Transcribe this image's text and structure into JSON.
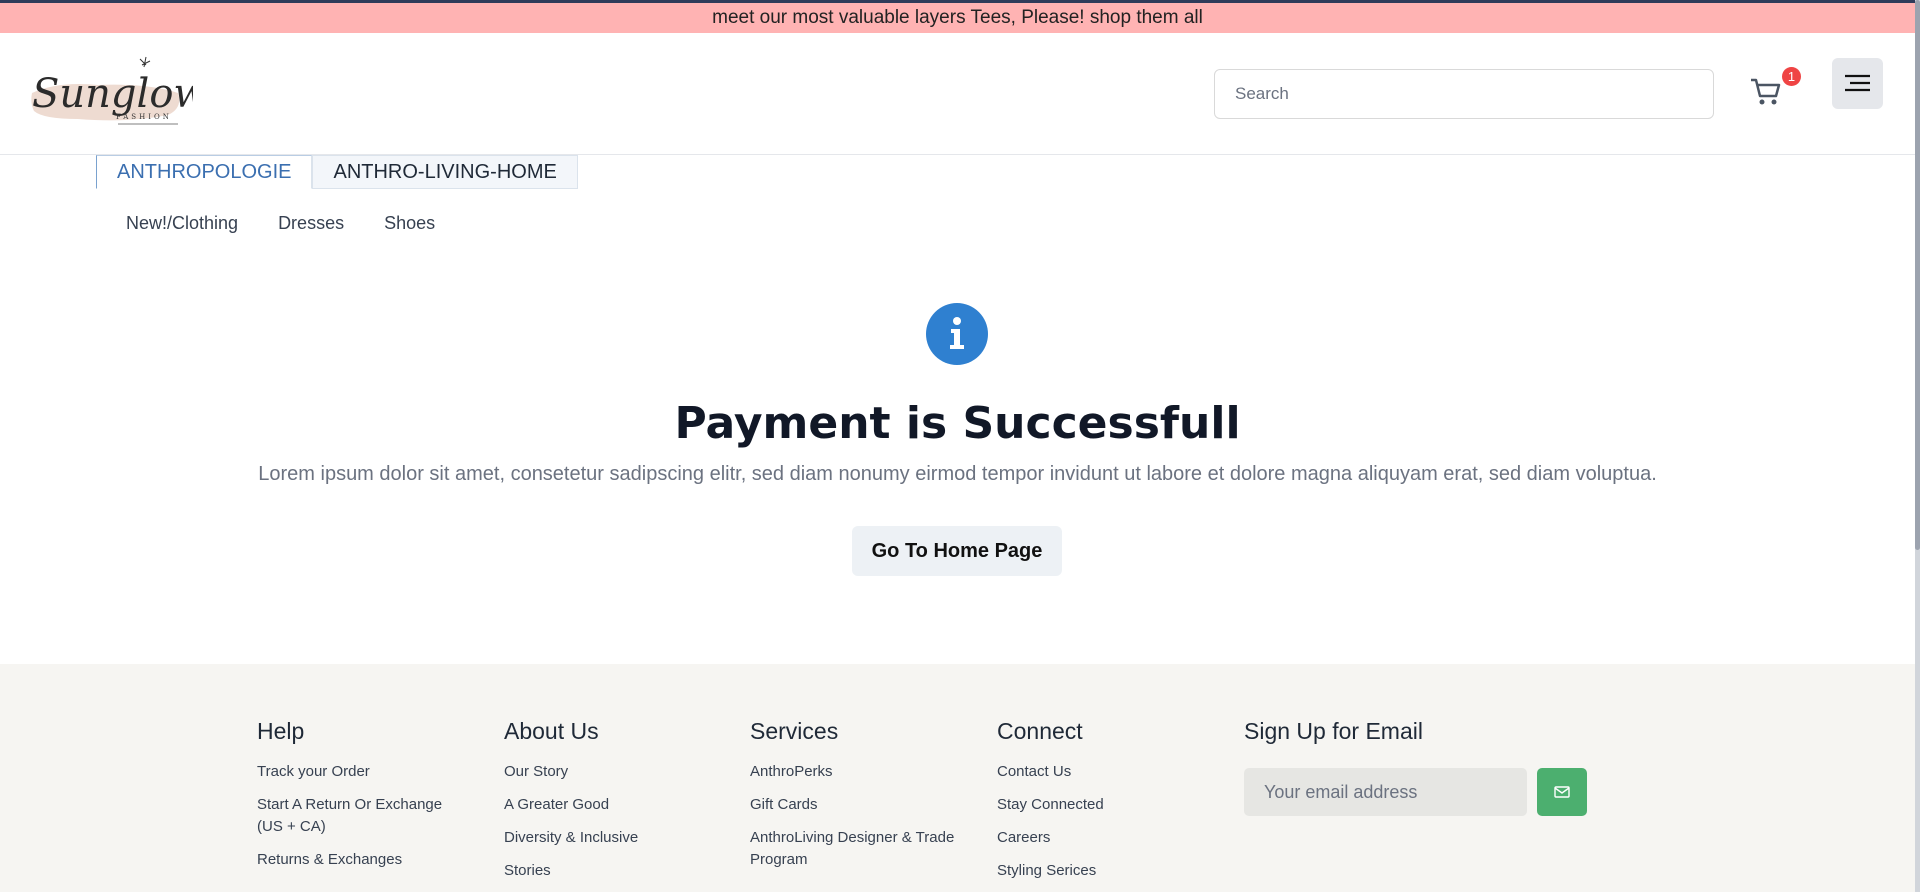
{
  "promo": {
    "text": "meet our most valuable layers Tees, Please! shop them all"
  },
  "header": {
    "logo": {
      "script": "Sunglow",
      "sub": "FASHION"
    },
    "search": {
      "placeholder": "Search"
    },
    "cart": {
      "count": "1"
    }
  },
  "tabs": [
    {
      "label": "ANTHROPOLOGIE",
      "active": true
    },
    {
      "label": "ANTHRO-LIVING-HOME",
      "active": false
    }
  ],
  "subnav": [
    "New!/Clothing",
    "Dresses",
    "Shoes"
  ],
  "main": {
    "title": "Payment is Successfull",
    "description": "Lorem ipsum dolor sit amet, consetetur sadipscing elitr, sed diam nonumy eirmod tempor invidunt ut labore et dolore magna aliquyam erat, sed diam voluptua.",
    "button": "Go To Home Page"
  },
  "footer": {
    "help": {
      "heading": "Help",
      "links": [
        "Track your Order",
        "Start A Return Or Exchange (US + CA)",
        "Returns & Exchanges"
      ]
    },
    "about": {
      "heading": "About Us",
      "links": [
        "Our Story",
        "A Greater Good",
        "Diversity & Inclusive",
        "Stories"
      ]
    },
    "services": {
      "heading": "Services",
      "links": [
        "AnthroPerks",
        "Gift Cards",
        "AnthroLiving Designer & Trade Program"
      ]
    },
    "connect": {
      "heading": "Connect",
      "links": [
        "Contact Us",
        "Stay Connected",
        "Careers",
        "Styling Serices"
      ]
    },
    "signup": {
      "heading": "Sign Up for Email",
      "placeholder": "Your email address"
    }
  },
  "colors": {
    "promo_bg": "#ffb3b3",
    "accent_blue": "#3b6fb0",
    "info_icon": "#2f80d0",
    "submit_green": "#4caf6f",
    "badge_red": "#ef4444"
  }
}
